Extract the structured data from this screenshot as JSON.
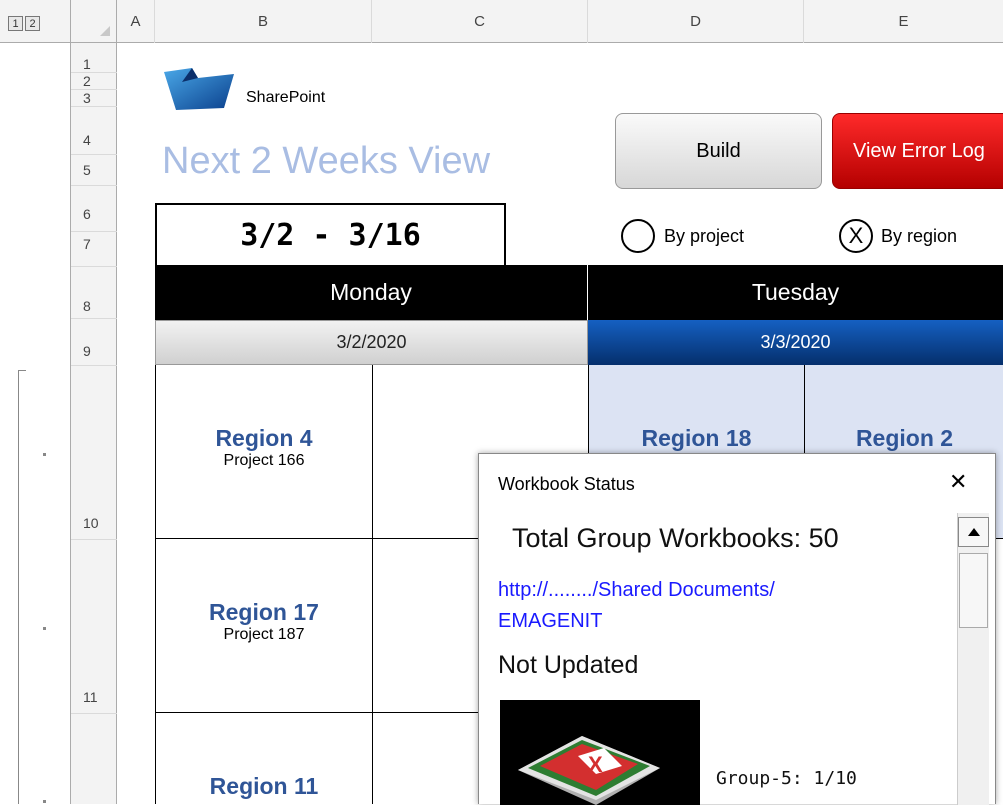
{
  "outline_levels": [
    "1",
    "2"
  ],
  "columns": [
    "A",
    "B",
    "C",
    "D",
    "E"
  ],
  "rows": [
    "1",
    "2",
    "3",
    "4",
    "5",
    "6",
    "7",
    "8",
    "9",
    "10",
    "11"
  ],
  "logo_text": "SharePoint",
  "view_title": "Next 2 Weeks View",
  "date_range": "3/2 - 3/16",
  "buttons": {
    "build": "Build",
    "view_error_log": "View Error Log"
  },
  "radios": [
    {
      "label": "By project",
      "selected": false
    },
    {
      "label": "By region",
      "selected": true,
      "mark": "X"
    }
  ],
  "days": [
    {
      "name": "Monday",
      "date": "3/2/2020"
    },
    {
      "name": "Tuesday",
      "date": "3/3/2020"
    }
  ],
  "schedule": {
    "r1": {
      "b_region": "Region 4",
      "b_project": "Project 166",
      "d_region": "Region 18",
      "e_region": "Region 2"
    },
    "r2": {
      "b_region": "Region 17",
      "b_project": "Project 187"
    },
    "r3": {
      "b_region": "Region 11"
    }
  },
  "dialog": {
    "title": "Workbook Status",
    "close": "✕",
    "total": "Total Group Workbooks: 50",
    "link_line1": "http://......../Shared Documents/",
    "link_line2": "EMAGENIT",
    "status": "Not Updated",
    "group": "Group-5: 1/10"
  },
  "colors": {
    "title": "#a9bde3",
    "region": "#2f5597",
    "link": "#1a1aff",
    "selected_day": "#0a4e9e",
    "error_button": "#d40000"
  }
}
